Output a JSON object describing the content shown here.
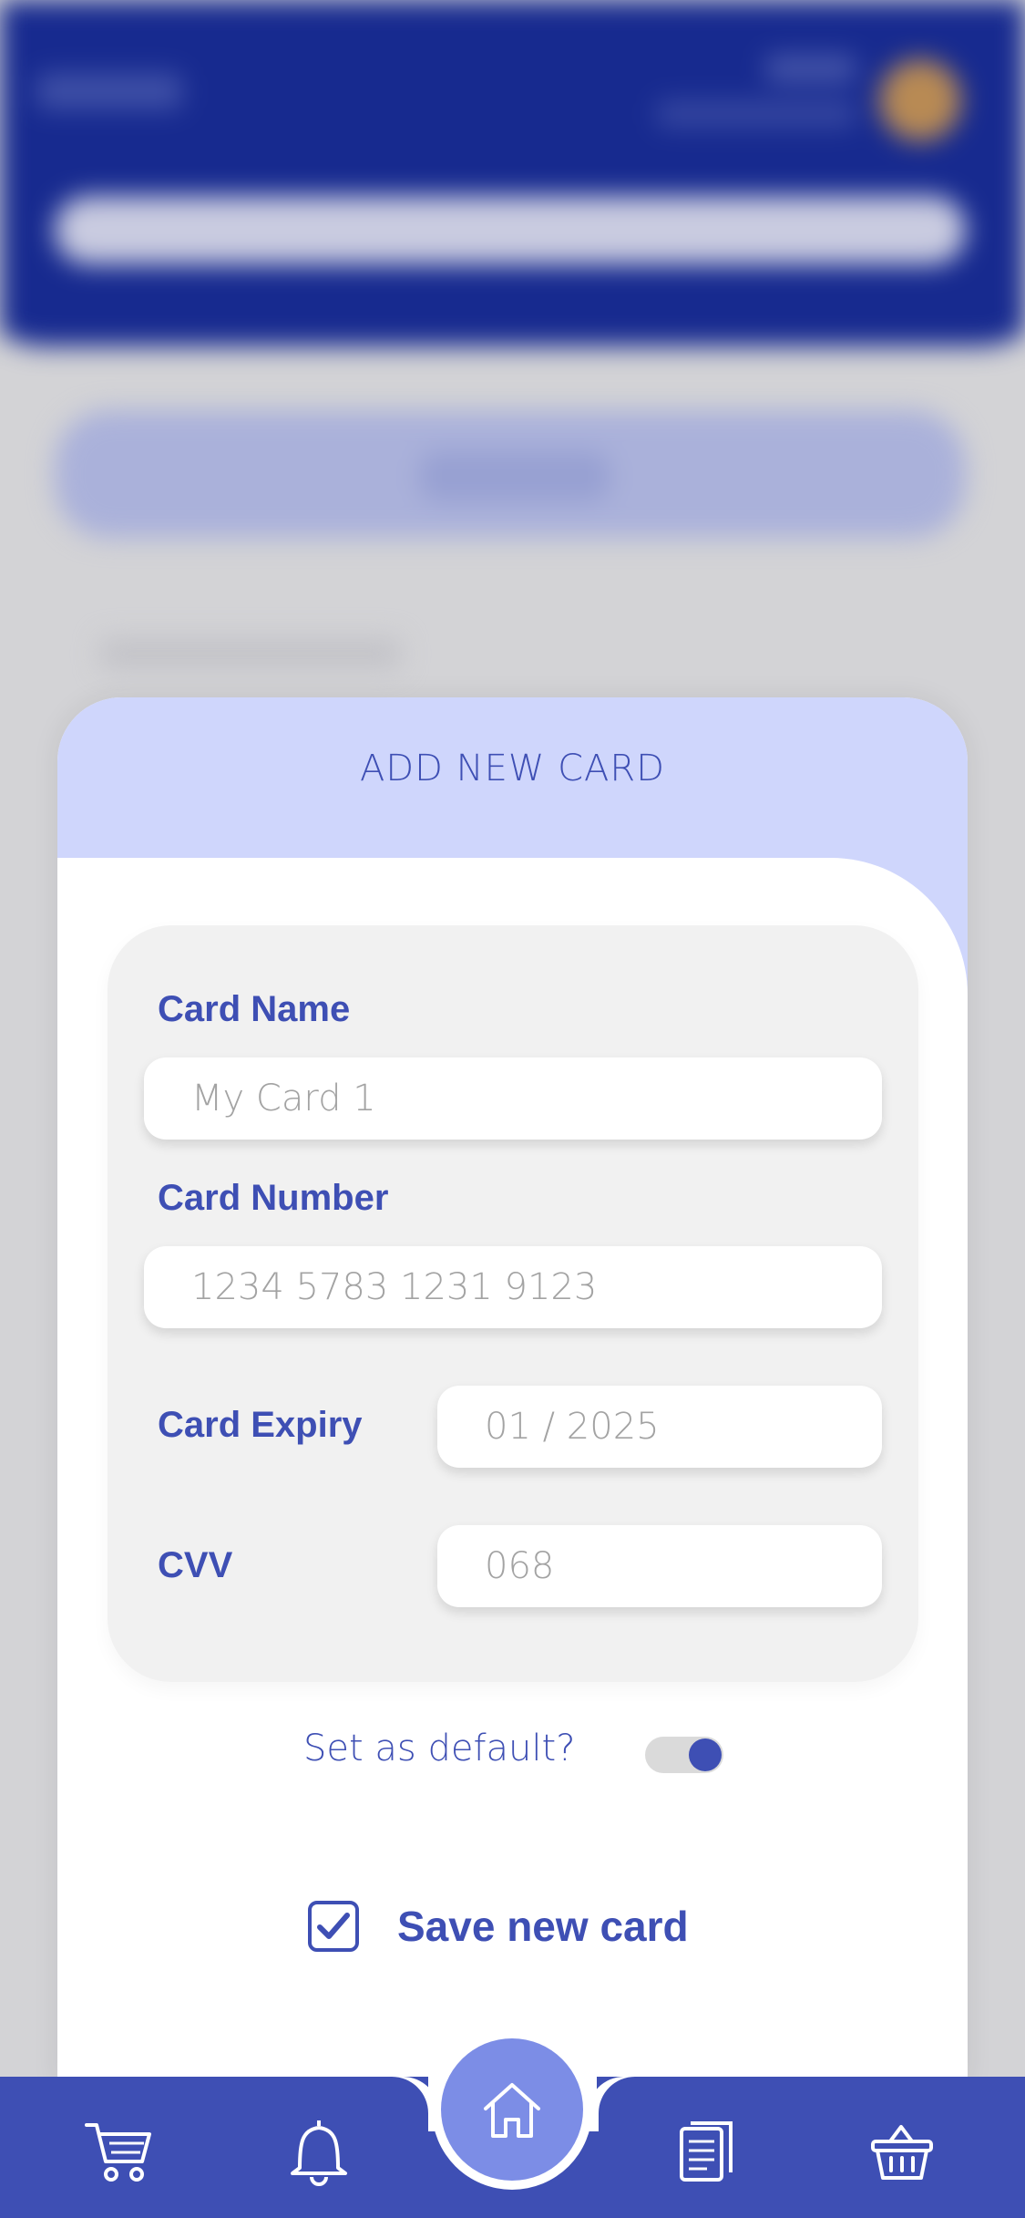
{
  "modal": {
    "title": "ADD NEW CARD"
  },
  "form": {
    "card_name": {
      "label": "Card Name",
      "placeholder": "My Card 1"
    },
    "card_number": {
      "label": "Card Number",
      "placeholder": "1234 5783 1231 9123"
    },
    "card_expiry": {
      "label": "Card Expiry",
      "placeholder": "01 / 2025"
    },
    "cvv": {
      "label": "CVV",
      "placeholder": "068"
    }
  },
  "default_toggle": {
    "label": "Set as default?",
    "on": true
  },
  "save": {
    "label": "Save new card",
    "checked": true
  },
  "nav": {
    "items": [
      {
        "icon": "cart-icon"
      },
      {
        "icon": "bell-icon"
      },
      {
        "icon": "home-icon",
        "active": true
      },
      {
        "icon": "document-icon"
      },
      {
        "icon": "basket-icon"
      }
    ]
  },
  "colors": {
    "accent": "#3e4fb4",
    "header_bg": "#172a8f",
    "modal_header": "#cfd6fc",
    "home_button": "#7c8de6"
  }
}
